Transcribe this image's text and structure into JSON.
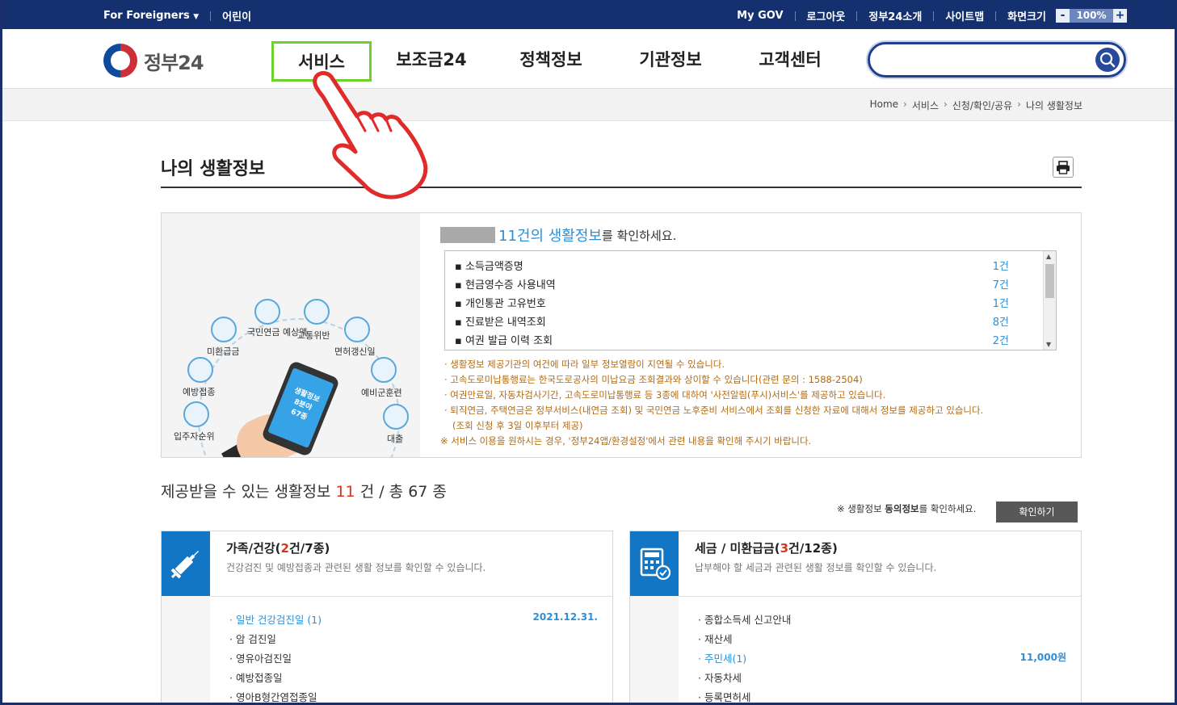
{
  "topbar": {
    "for_foreigners": "For Foreigners",
    "kids": "어린이",
    "my_gov": "My GOV",
    "logout": "로그아웃",
    "about": "정부24소개",
    "sitemap": "사이트맵",
    "screen_size": "화면크기",
    "zoom_minus": "-",
    "zoom_value": "100%",
    "zoom_plus": "+"
  },
  "header": {
    "logo_text": "정부24",
    "nav": [
      "서비스",
      "보조금24",
      "정책정보",
      "기관정보",
      "고객센터"
    ],
    "search_placeholder": ""
  },
  "breadcrumb": [
    "Home",
    "서비스",
    "신청/확인/공유",
    "나의 생활정보"
  ],
  "page_title": "나의 생활정보",
  "illustration": {
    "labels": [
      "국민연금 예상액",
      "교통위반",
      "미환급금",
      "면허갱신일",
      "예방접종",
      "예비군훈련",
      "입주자순위",
      "대출"
    ],
    "phone_text": [
      "생활정보",
      "8분야",
      "67종"
    ]
  },
  "summary": {
    "prefix_masked": "",
    "highlight": "11건의 생활정보",
    "suffix": "를 확인하세요."
  },
  "life_info_list": [
    {
      "name": "소득금액증명",
      "count": "1건"
    },
    {
      "name": "현금영수증 사용내역",
      "count": "7건"
    },
    {
      "name": "개인통관 고유번호",
      "count": "1건"
    },
    {
      "name": "진료받은 내역조회",
      "count": "8건"
    },
    {
      "name": "여권 발급 이력 조회",
      "count": "2건"
    }
  ],
  "notes": [
    "· 생활정보 제공기관의 여건에 따라 일부 정보열람이 지연될 수 있습니다.",
    "· 고속도로미납통행료는 한국도로공사의 미납요금 조회결과와 상이할 수 있습니다(관련 문의 : 1588-2504)",
    "· 여권만료일, 자동차검사기간, 고속도로미납통행료 등 3종에 대하여 '사전알림(푸시)서비스'를 제공하고 있습니다.",
    "· 퇴직연금, 주택연금은 정부서비스(내연금 조회) 및 국민연금 노후준비 서비스에서 조회를 신청한 자료에 대해서 정보를 제공하고 있습니다.",
    "  (조회 신청 후 3일 이후부터 제공)",
    "※ 서비스 이용을 원하시는 경우, '정부24앱/환경설정'에서 관련 내용을 확인해 주시기 바랍니다."
  ],
  "stats": {
    "prefix": "제공받을 수 있는 생활정보",
    "count": "11",
    "mid": "건 / 총",
    "total": "67",
    "suffix": "종"
  },
  "consent": {
    "text_a": "※ 생활정보 ",
    "text_b": "동의정보",
    "text_c": "를 확인하세요.",
    "button": "확인하기"
  },
  "cards": [
    {
      "title_a": "가족/건강(",
      "title_count": "2",
      "title_b": "건/7종)",
      "desc": "건강검진 및 예방접종과 관련된 생활 정보를 확인할 수 있습니다.",
      "rows": [
        {
          "label": "· 일반 건강검진일 (1)",
          "value": "2021.12.31.",
          "hi": true
        },
        {
          "label": "· 암 검진일",
          "value": "",
          "hi": false
        },
        {
          "label": "· 영유아검진일",
          "value": "",
          "hi": false
        },
        {
          "label": "· 예방접종일",
          "value": "",
          "hi": false
        },
        {
          "label": "· 영아B형간염접종일",
          "value": "",
          "hi": false
        }
      ]
    },
    {
      "title_a": "세금 / 미환급금(",
      "title_count": "3",
      "title_b": "건/12종)",
      "desc": "납부해야 할 세금과 관련된 생활 정보를 확인할 수 있습니다.",
      "rows": [
        {
          "label": "· 종합소득세 신고안내",
          "value": "",
          "hi": false
        },
        {
          "label": "· 재산세",
          "value": "",
          "hi": false
        },
        {
          "label": "· 주민세(1)",
          "value": "11,000원",
          "hi": true
        },
        {
          "label": "· 자동차세",
          "value": "",
          "hi": false
        },
        {
          "label": "· 등록면허세",
          "value": "",
          "hi": false
        }
      ]
    }
  ],
  "colors": {
    "topbar": "#14306e",
    "accent_blue": "#2d8fd6",
    "card_icon": "#1376c5",
    "highlight_red": "#d9341f",
    "note_orange": "#b26a12",
    "nav_active_border": "#6fd12b"
  },
  "icons": {
    "dropdown": "caret-down-icon",
    "search": "search-icon",
    "print": "printer-icon",
    "card1": "syringe-icon",
    "card2": "calculator-check-icon",
    "pointer": "pointing-hand-icon"
  }
}
